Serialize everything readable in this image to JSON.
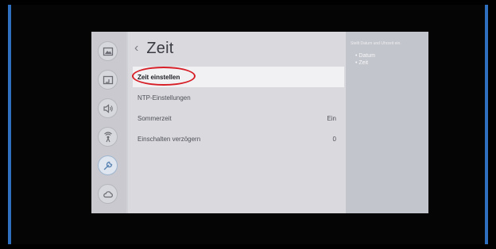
{
  "settings": {
    "title": "Zeit",
    "items": [
      {
        "label": "Zeit einstellen",
        "value": ""
      },
      {
        "label": "NTP-Einstellungen",
        "value": ""
      },
      {
        "label": "Sommerzeit",
        "value": "Ein"
      },
      {
        "label": "Einschalten verzögern",
        "value": "0"
      }
    ]
  },
  "side_panel": {
    "description": "Stellt Datum und Uhrzeit ein.",
    "bullets": [
      "• Datum",
      "• Zeit"
    ]
  },
  "rail_icons": [
    "picture-icon",
    "input-icon",
    "sound-icon",
    "network-icon",
    "support-wrench-icon",
    "cloud-icon"
  ],
  "colors": {
    "highlight_oval": "#d71f27",
    "frame_border": "#2f6fc0"
  }
}
